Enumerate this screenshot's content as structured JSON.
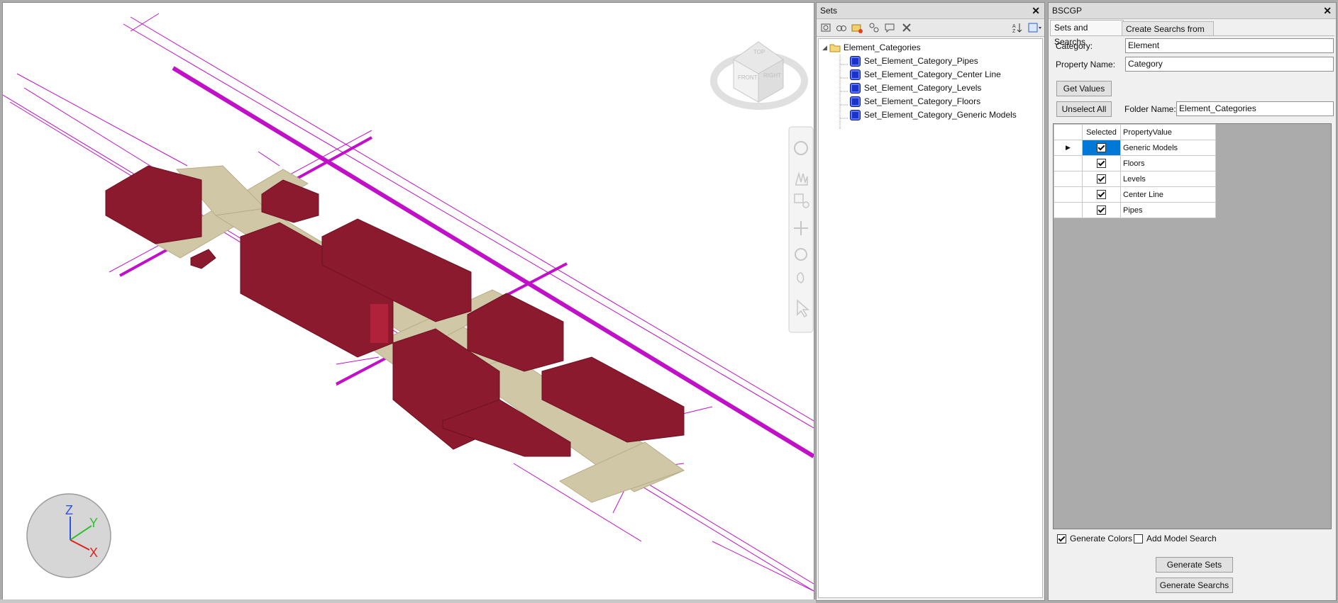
{
  "sets_panel": {
    "title": "Sets",
    "tree": {
      "root_label": "Element_Categories",
      "items": [
        {
          "label": "Set_Element_Category_Pipes"
        },
        {
          "label": "Set_Element_Category_Center Line"
        },
        {
          "label": "Set_Element_Category_Levels"
        },
        {
          "label": "Set_Element_Category_Floors"
        },
        {
          "label": "Set_Element_Category_Generic Models"
        }
      ]
    },
    "toolbar_icons": [
      "save-selection-icon",
      "save-search-icon",
      "new-folder-icon",
      "duplicate-icon",
      "add-comment-icon",
      "delete-icon",
      "sort-icon",
      "import-export-icon"
    ]
  },
  "bscgp_panel": {
    "title": "BSCGP",
    "tabs": [
      {
        "label": "Sets and Searchs",
        "active": true
      },
      {
        "label": "Create Searchs from DB",
        "active": false
      }
    ],
    "category_label": "Category:",
    "category_value": "Element",
    "property_name_label": "Property Name:",
    "property_name_value": "Category",
    "get_values_button": "Get Values",
    "unselect_all_button": "Unselect All",
    "folder_name_label": "Folder Name:",
    "folder_name_value": "Element_Categories",
    "grid": {
      "headers": {
        "selected": "Selected",
        "property_value": "PropertyValue"
      },
      "rows": [
        {
          "value": "Generic Models",
          "checked": true,
          "current": true
        },
        {
          "value": "Floors",
          "checked": true,
          "current": false
        },
        {
          "value": "Levels",
          "checked": true,
          "current": false
        },
        {
          "value": "Center Line",
          "checked": true,
          "current": false
        },
        {
          "value": "Pipes",
          "checked": true,
          "current": false
        }
      ]
    },
    "generate_colors_label": "Generate Colors",
    "generate_colors_checked": true,
    "add_model_search_label": "Add Model Search",
    "add_model_search_checked": false,
    "generate_sets_button": "Generate Sets",
    "generate_searchs_button": "Generate Searchs"
  },
  "viewcube": {
    "top": "TOP",
    "front": "FRONT",
    "right": "RIGHT"
  },
  "axes": {
    "z": "Z",
    "y": "Y",
    "x": "X"
  },
  "colors": {
    "building": "#8b1a2e",
    "road": "#cfc7a6",
    "pipe": "#c010c8",
    "selection": "#0078d7"
  }
}
